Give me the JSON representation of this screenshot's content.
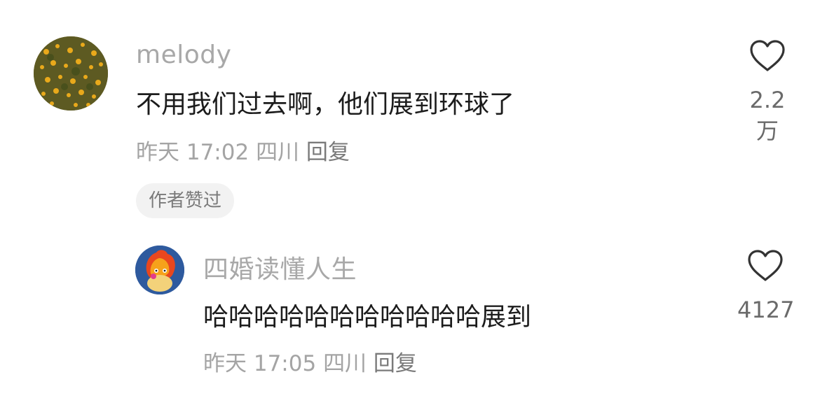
{
  "comment": {
    "username": "melody",
    "text": "不用我们过去啊，他们展到环球了",
    "time": "昨天 17:02",
    "location": "四川",
    "reply_label": "回复",
    "badge": "作者赞过",
    "likes": "2.2万"
  },
  "reply": {
    "username": "四婚读懂人生",
    "text": "哈哈哈哈哈哈哈哈哈哈哈展到",
    "time": "昨天 17:05",
    "location": "四川",
    "reply_label": "回复",
    "likes": "4127"
  }
}
